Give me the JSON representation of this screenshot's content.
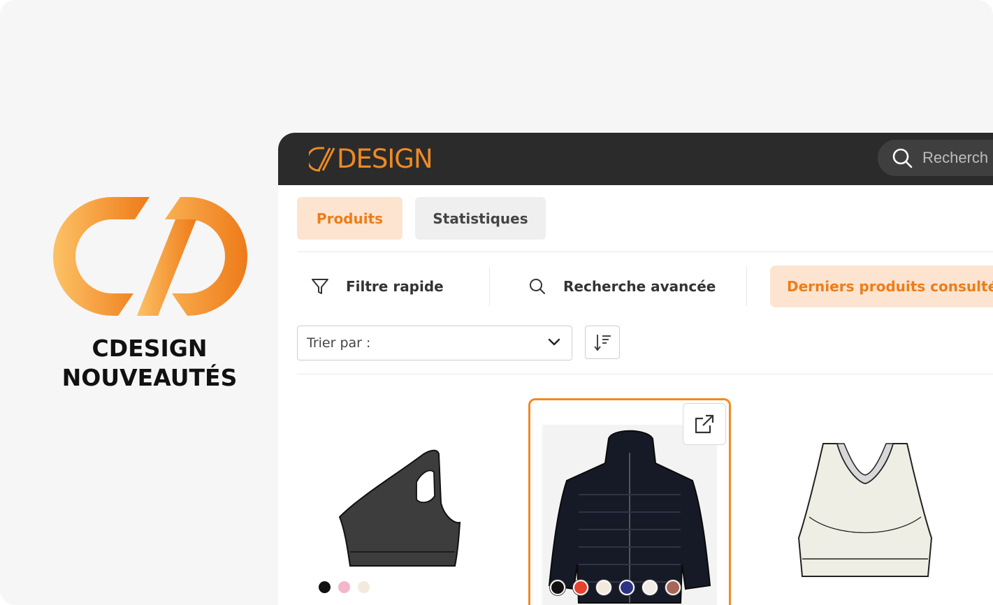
{
  "brand": {
    "title_line1": "CDESIGN",
    "title_line2": "NOUVEAUTÉS",
    "logo_gradient": [
      "#fcbf5c",
      "#ef7d1a"
    ]
  },
  "app": {
    "logo_text": "DESIGN",
    "search_placeholder": "Recherch",
    "accent_color": "#ee7d17",
    "header_color": "#2b2b2b"
  },
  "tabs": [
    {
      "label": "Produits",
      "active": true
    },
    {
      "label": "Statistiques",
      "active": false
    }
  ],
  "filters": {
    "quick_label": "Filtre rapide",
    "advanced_label": "Recherche avancée",
    "recent_label": "Derniers produits consultés"
  },
  "sort": {
    "label": "Trier par :"
  },
  "products": [
    {
      "name": "one-shoulder-bra-sketch",
      "colors": [
        "#111111",
        "#f4b6c8",
        "#f3e9dd"
      ]
    },
    {
      "name": "puffer-jacket-photo",
      "selected": true,
      "colors": [
        "#111111",
        "#e8412c",
        "#f3e9dd",
        "#2c3380",
        "#f0ebe4",
        "#a86658"
      ]
    },
    {
      "name": "racerback-sports-bra-sketch",
      "colors": []
    }
  ]
}
